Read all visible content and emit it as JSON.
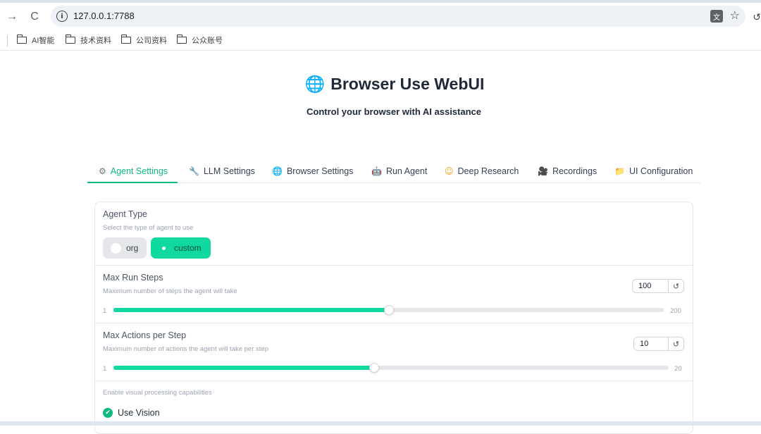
{
  "browser": {
    "url": "127.0.0.1:7788",
    "bookmarks": [
      "AI智能",
      "技术资料",
      "公司资料",
      "公众账号"
    ]
  },
  "page": {
    "title": "Browser Use WebUI",
    "subtitle": "Control your browser with AI assistance",
    "accent_color": "#10b981"
  },
  "tabs": [
    {
      "label": "Agent Settings",
      "icon": "gear-icon",
      "active": true
    },
    {
      "label": "LLM Settings",
      "icon": "wrench-icon",
      "active": false
    },
    {
      "label": "Browser Settings",
      "icon": "globe-icon",
      "active": false
    },
    {
      "label": "Run Agent",
      "icon": "robot-icon",
      "active": false
    },
    {
      "label": "Deep Research",
      "icon": "face-icon",
      "active": false
    },
    {
      "label": "Recordings",
      "icon": "camera-icon",
      "active": false
    },
    {
      "label": "UI Configuration",
      "icon": "folder-icon",
      "active": false
    }
  ],
  "agent_type": {
    "label": "Agent Type",
    "info": "Select the type of agent to use",
    "options": [
      "org",
      "custom"
    ],
    "selected": "custom"
  },
  "max_run_steps": {
    "label": "Max Run Steps",
    "info": "Maximum number of steps the agent will take",
    "value": "100",
    "min": "1",
    "max": "200",
    "fraction": 0.5
  },
  "max_actions": {
    "label": "Max Actions per Step",
    "info": "Maximum number of actions the agent will take per step",
    "value": "10",
    "min": "1",
    "max": "20",
    "fraction": 0.47
  },
  "vision": {
    "info": "Enable visual processing capabilities",
    "label": "Use Vision",
    "checked": true
  }
}
